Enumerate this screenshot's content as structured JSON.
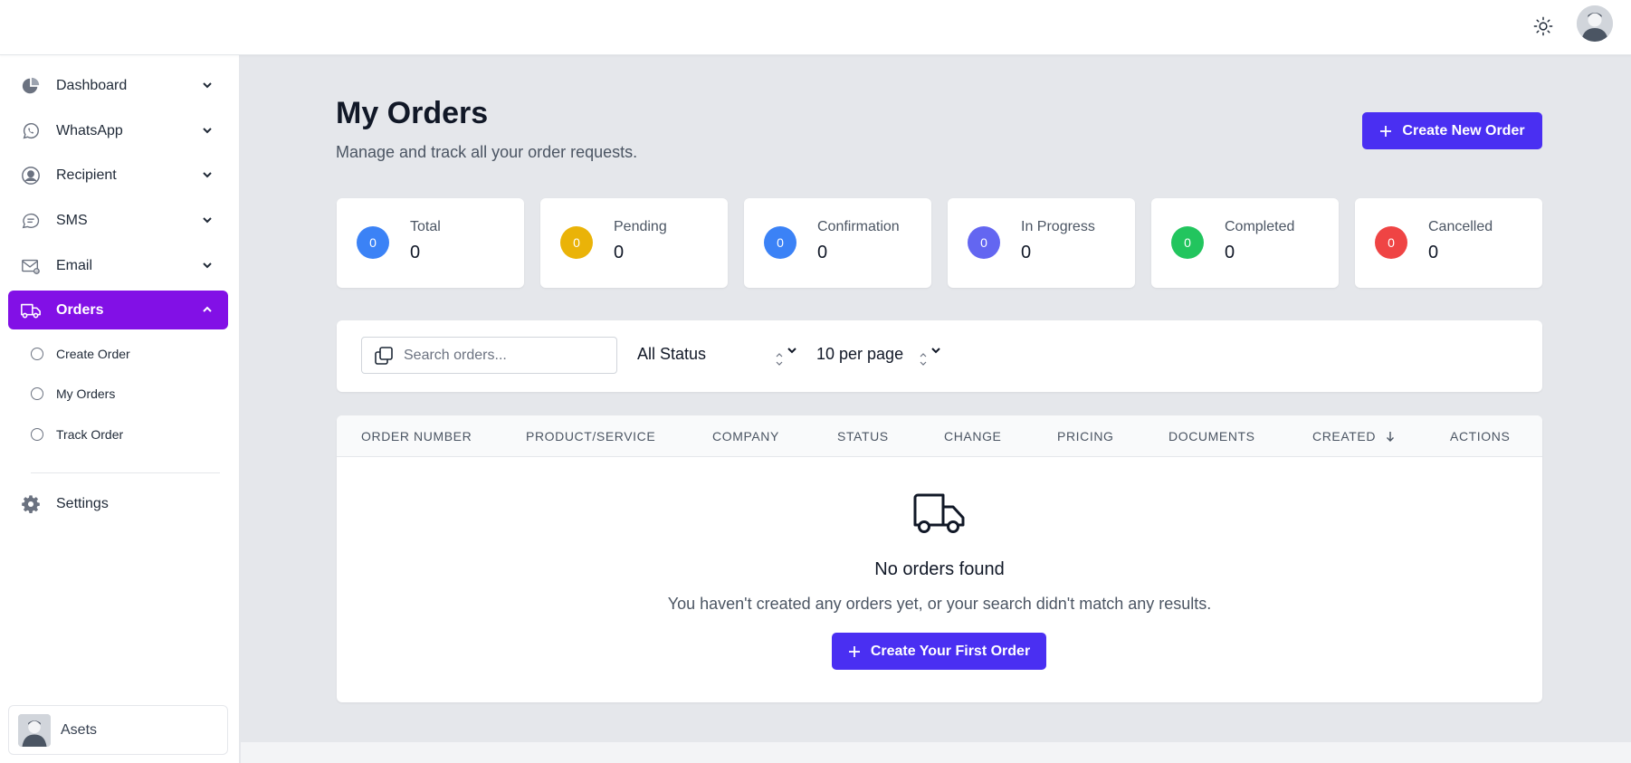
{
  "sidebar": {
    "items": [
      {
        "label": "Dashboard"
      },
      {
        "label": "WhatsApp"
      },
      {
        "label": "Recipient"
      },
      {
        "label": "SMS"
      },
      {
        "label": "Email"
      },
      {
        "label": "Orders"
      }
    ],
    "orders_subitems": [
      {
        "label": "Create Order"
      },
      {
        "label": "My Orders"
      },
      {
        "label": "Track Order"
      }
    ],
    "settings_label": "Settings",
    "user_name": "Asets"
  },
  "header": {
    "title": "My Orders",
    "subtitle": "Manage and track all your order requests.",
    "create_button": "Create New Order"
  },
  "stats": [
    {
      "label": "Total",
      "value": "0",
      "badge": "0",
      "color": "#3b82f6"
    },
    {
      "label": "Pending",
      "value": "0",
      "badge": "0",
      "color": "#eab308"
    },
    {
      "label": "Confirmation",
      "value": "0",
      "badge": "0",
      "color": "#3b82f6"
    },
    {
      "label": "In Progress",
      "value": "0",
      "badge": "0",
      "color": "#6366f1"
    },
    {
      "label": "Completed",
      "value": "0",
      "badge": "0",
      "color": "#22c55e"
    },
    {
      "label": "Cancelled",
      "value": "0",
      "badge": "0",
      "color": "#ef4444"
    }
  ],
  "filters": {
    "search_placeholder": "Search orders...",
    "status_value": "All Status",
    "per_page_value": "10 per page"
  },
  "table": {
    "columns": [
      "ORDER NUMBER",
      "PRODUCT/SERVICE",
      "COMPANY",
      "STATUS",
      "CHANGE",
      "PRICING",
      "DOCUMENTS",
      "CREATED",
      "ACTIONS"
    ],
    "empty_title": "No orders found",
    "empty_description": "You haven't created any orders yet, or your search didn't match any results.",
    "empty_button": "Create Your First Order"
  },
  "colors": {
    "accent": "#4a2ff2",
    "active_nav": "#8210e6"
  }
}
